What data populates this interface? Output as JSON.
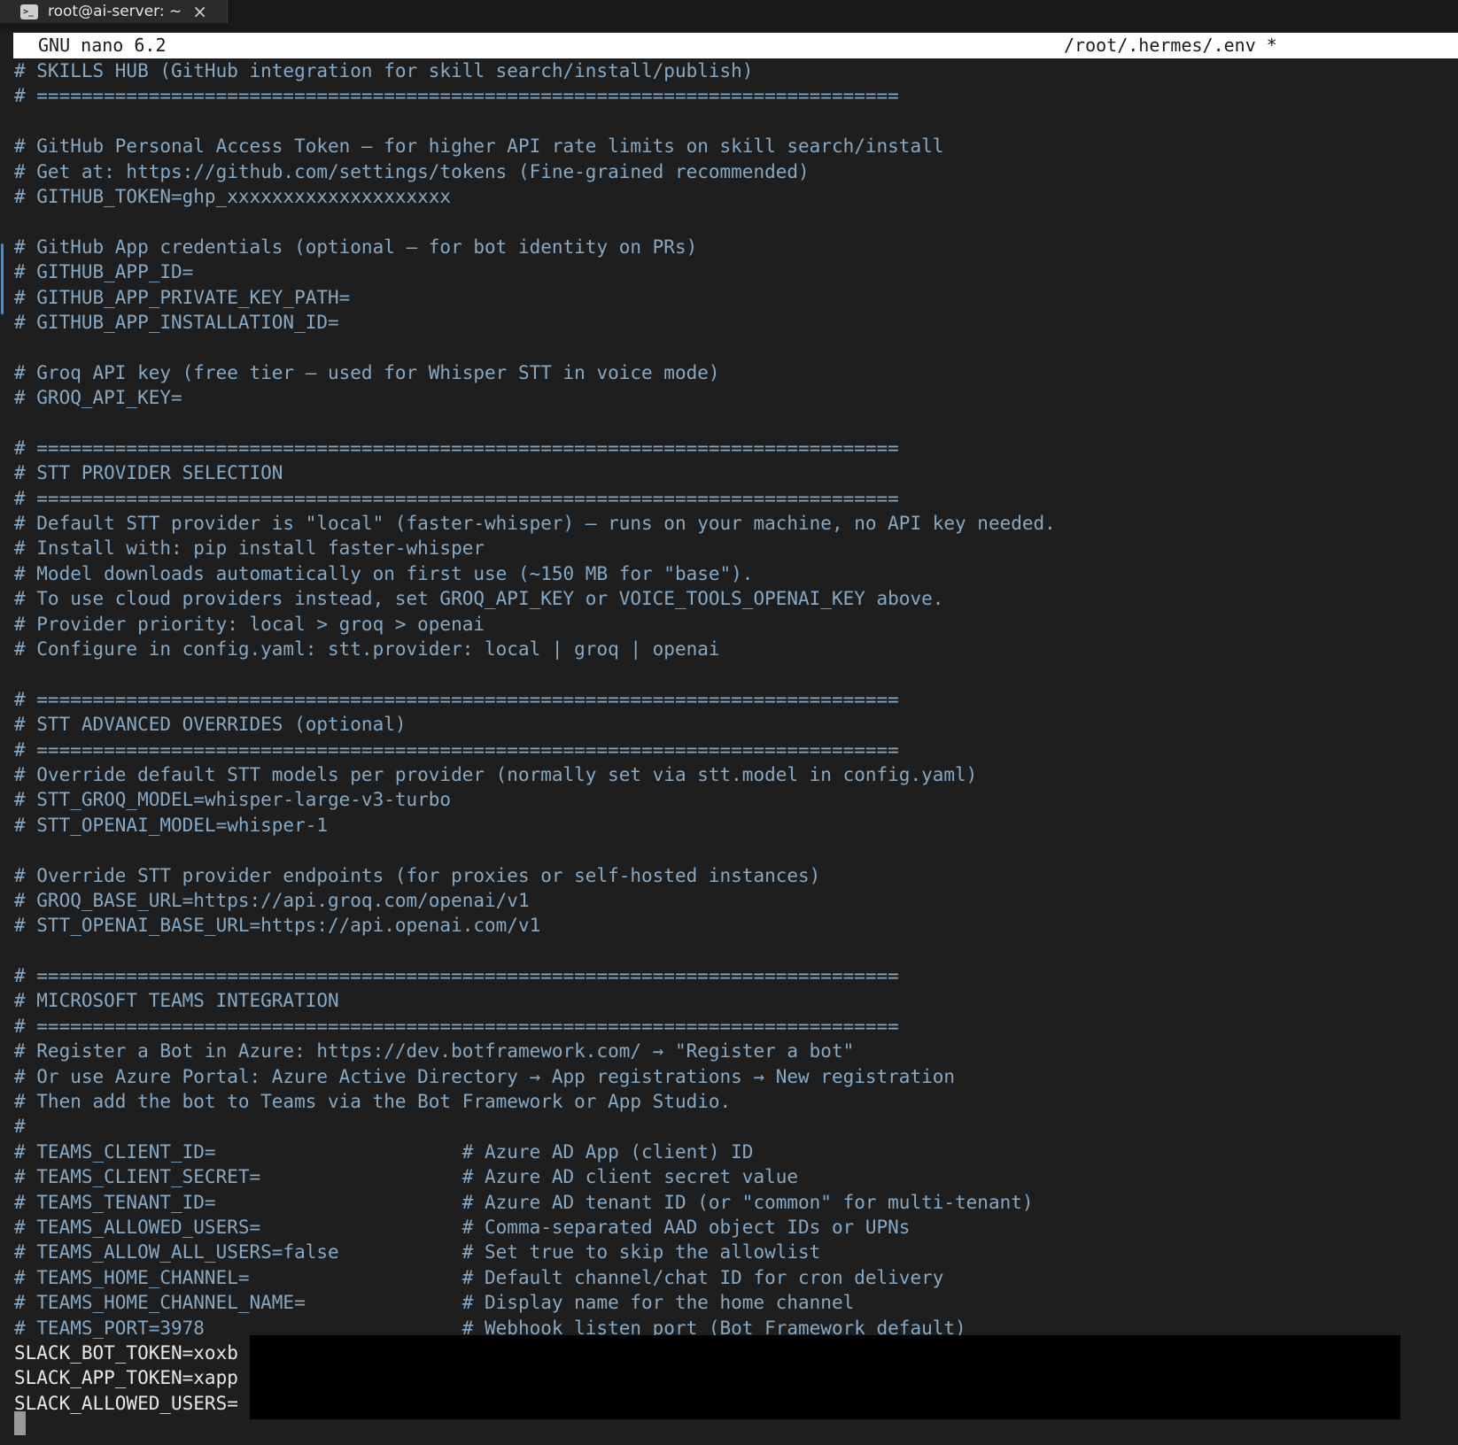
{
  "tab": {
    "title": "root@ai-server: ~",
    "icon": "terminal-icon",
    "close_icon": "close-icon"
  },
  "nano": {
    "version": "GNU nano 6.2",
    "filename": "/root/.hermes/.env *"
  },
  "lines": [
    {
      "text": "# SKILLS HUB (GitHub integration for skill search/install/publish)",
      "kind": "comment"
    },
    {
      "text": "# =============================================================================",
      "kind": "comment"
    },
    {
      "text": "",
      "kind": "blank"
    },
    {
      "text": "# GitHub Personal Access Token — for higher API rate limits on skill search/install",
      "kind": "comment"
    },
    {
      "text": "# Get at: https://github.com/settings/tokens (Fine-grained recommended)",
      "kind": "comment"
    },
    {
      "text": "# GITHUB_TOKEN=ghp_xxxxxxxxxxxxxxxxxxxx",
      "kind": "comment"
    },
    {
      "text": "",
      "kind": "blank"
    },
    {
      "text": "# GitHub App credentials (optional — for bot identity on PRs)",
      "kind": "comment"
    },
    {
      "text": "# GITHUB_APP_ID=",
      "kind": "comment"
    },
    {
      "text": "# GITHUB_APP_PRIVATE_KEY_PATH=",
      "kind": "comment"
    },
    {
      "text": "# GITHUB_APP_INSTALLATION_ID=",
      "kind": "comment"
    },
    {
      "text": "",
      "kind": "blank"
    },
    {
      "text": "# Groq API key (free tier — used for Whisper STT in voice mode)",
      "kind": "comment"
    },
    {
      "text": "# GROQ_API_KEY=",
      "kind": "comment"
    },
    {
      "text": "",
      "kind": "blank"
    },
    {
      "text": "# =============================================================================",
      "kind": "comment"
    },
    {
      "text": "# STT PROVIDER SELECTION",
      "kind": "comment"
    },
    {
      "text": "# =============================================================================",
      "kind": "comment"
    },
    {
      "text": "# Default STT provider is \"local\" (faster-whisper) — runs on your machine, no API key needed.",
      "kind": "comment"
    },
    {
      "text": "# Install with: pip install faster-whisper",
      "kind": "comment"
    },
    {
      "text": "# Model downloads automatically on first use (~150 MB for \"base\").",
      "kind": "comment"
    },
    {
      "text": "# To use cloud providers instead, set GROQ_API_KEY or VOICE_TOOLS_OPENAI_KEY above.",
      "kind": "comment"
    },
    {
      "text": "# Provider priority: local > groq > openai",
      "kind": "comment"
    },
    {
      "text": "# Configure in config.yaml: stt.provider: local | groq | openai",
      "kind": "comment"
    },
    {
      "text": "",
      "kind": "blank"
    },
    {
      "text": "# =============================================================================",
      "kind": "comment"
    },
    {
      "text": "# STT ADVANCED OVERRIDES (optional)",
      "kind": "comment"
    },
    {
      "text": "# =============================================================================",
      "kind": "comment"
    },
    {
      "text": "# Override default STT models per provider (normally set via stt.model in config.yaml)",
      "kind": "comment"
    },
    {
      "text": "# STT_GROQ_MODEL=whisper-large-v3-turbo",
      "kind": "comment"
    },
    {
      "text": "# STT_OPENAI_MODEL=whisper-1",
      "kind": "comment"
    },
    {
      "text": "",
      "kind": "blank"
    },
    {
      "text": "# Override STT provider endpoints (for proxies or self-hosted instances)",
      "kind": "comment"
    },
    {
      "text": "# GROQ_BASE_URL=https://api.groq.com/openai/v1",
      "kind": "comment"
    },
    {
      "text": "# STT_OPENAI_BASE_URL=https://api.openai.com/v1",
      "kind": "comment"
    },
    {
      "text": "",
      "kind": "blank"
    },
    {
      "text": "# =============================================================================",
      "kind": "comment"
    },
    {
      "text": "# MICROSOFT TEAMS INTEGRATION",
      "kind": "comment"
    },
    {
      "text": "# =============================================================================",
      "kind": "comment"
    },
    {
      "text": "# Register a Bot in Azure: https://dev.botframework.com/ → \"Register a bot\"",
      "kind": "comment"
    },
    {
      "text": "# Or use Azure Portal: Azure Active Directory → App registrations → New registration",
      "kind": "comment"
    },
    {
      "text": "# Then add the bot to Teams via the Bot Framework or App Studio.",
      "kind": "comment"
    },
    {
      "text": "#",
      "kind": "comment"
    },
    {
      "text": "# TEAMS_CLIENT_ID=                      # Azure AD App (client) ID",
      "kind": "comment"
    },
    {
      "text": "# TEAMS_CLIENT_SECRET=                  # Azure AD client secret value",
      "kind": "comment"
    },
    {
      "text": "# TEAMS_TENANT_ID=                      # Azure AD tenant ID (or \"common\" for multi-tenant)",
      "kind": "comment"
    },
    {
      "text": "# TEAMS_ALLOWED_USERS=                  # Comma-separated AAD object IDs or UPNs",
      "kind": "comment"
    },
    {
      "text": "# TEAMS_ALLOW_ALL_USERS=false           # Set true to skip the allowlist",
      "kind": "comment"
    },
    {
      "text": "# TEAMS_HOME_CHANNEL=                   # Default channel/chat ID for cron delivery",
      "kind": "comment"
    },
    {
      "text": "# TEAMS_HOME_CHANNEL_NAME=              # Display name for the home channel",
      "kind": "comment"
    },
    {
      "text": "# TEAMS_PORT=3978                       # Webhook listen port (Bot Framework default)",
      "kind": "comment"
    },
    {
      "text": "SLACK_BOT_TOKEN=xoxb",
      "kind": "plain"
    },
    {
      "text": "SLACK_APP_TOKEN=xapp",
      "kind": "plain"
    },
    {
      "text": "SLACK_ALLOWED_USERS=",
      "kind": "plain"
    }
  ]
}
